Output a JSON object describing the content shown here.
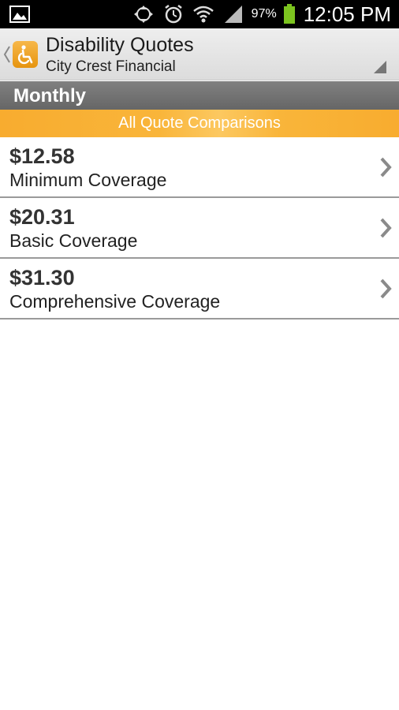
{
  "status_bar": {
    "battery_percent": "97%",
    "time": "12:05 PM"
  },
  "action_bar": {
    "title": "Disability Quotes",
    "subtitle": "City Crest Financial",
    "app_icon": "wheelchair-icon"
  },
  "section": {
    "label": "Monthly"
  },
  "banner": {
    "label": "All Quote Comparisons"
  },
  "quotes": [
    {
      "price": "$12.58",
      "name": "Minimum Coverage"
    },
    {
      "price": "$20.31",
      "name": "Basic Coverage"
    },
    {
      "price": "$31.30",
      "name": "Comprehensive Coverage"
    }
  ],
  "colors": {
    "banner_orange": "#f8ac2f",
    "section_gray": "#707070",
    "battery_green": "#7cc41f"
  }
}
